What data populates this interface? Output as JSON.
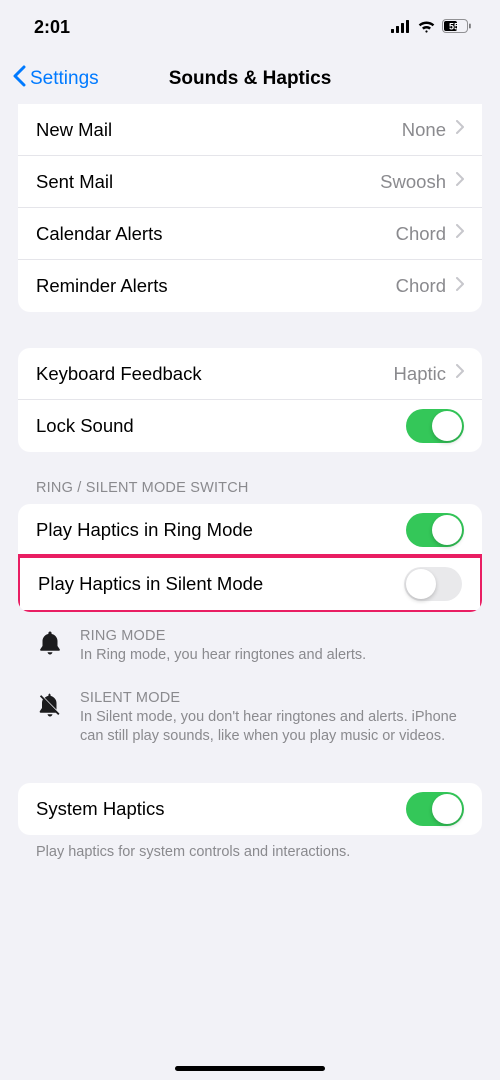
{
  "status": {
    "time": "2:01",
    "battery": "55"
  },
  "nav": {
    "back": "Settings",
    "title": "Sounds & Haptics"
  },
  "group1": {
    "new_mail": {
      "label": "New Mail",
      "value": "None"
    },
    "sent_mail": {
      "label": "Sent Mail",
      "value": "Swoosh"
    },
    "calendar": {
      "label": "Calendar Alerts",
      "value": "Chord"
    },
    "reminder": {
      "label": "Reminder Alerts",
      "value": "Chord"
    }
  },
  "group2": {
    "keyboard": {
      "label": "Keyboard Feedback",
      "value": "Haptic"
    },
    "lock": {
      "label": "Lock Sound"
    }
  },
  "section_header": "RING / SILENT MODE SWITCH",
  "group3": {
    "ring": {
      "label": "Play Haptics in Ring Mode"
    },
    "silent": {
      "label": "Play Haptics in Silent Mode"
    }
  },
  "info": {
    "ring_title": "RING MODE",
    "ring_desc": "In Ring mode, you hear ringtones and alerts.",
    "silent_title": "SILENT MODE",
    "silent_desc": "In Silent mode, you don't hear ringtones and alerts. iPhone can still play sounds, like when you play music or videos."
  },
  "group4": {
    "system": {
      "label": "System Haptics"
    }
  },
  "footer": "Play haptics for system controls and interactions."
}
